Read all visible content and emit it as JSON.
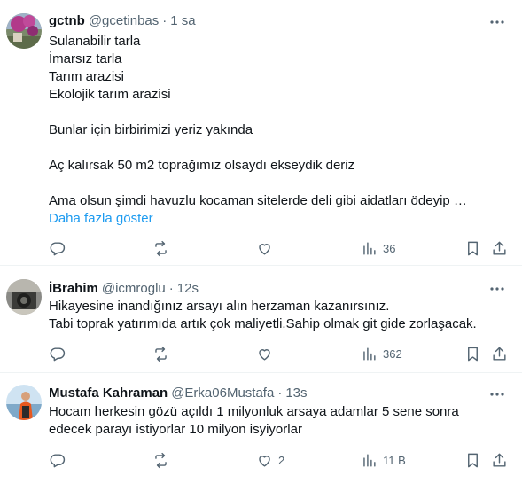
{
  "tweets": [
    {
      "name": "gctnb",
      "handle": "@gcetinbas",
      "separator": "·",
      "time": "1 sa",
      "lines": [
        "Sulanabilir tarla",
        "İmarsız tarla",
        "Tarım arazisi",
        "Ekolojik tarım arazisi",
        "",
        "Bunlar için birbirimizi yeriz yakında",
        "",
        "Aç kalırsak 50 m2 toprağımız olsaydı ekseydik deriz",
        "",
        "Ama olsun şimdi havuzlu kocaman sitelerde deli gibi aidatları ödeyip …"
      ],
      "show_more": "Daha fazla göster",
      "views": "36"
    },
    {
      "name": "İBrahim",
      "handle": "@icmroglu",
      "separator": "·",
      "time": "12s",
      "lines": [
        "Hikayesine inandığınız arsayı alın herzaman kazanırsınız.",
        "Tabi toprak yatırımıda artık çok maliyetli.Sahip olmak git gide zorlaşacak."
      ],
      "views": "362"
    },
    {
      "name": "Mustafa Kahraman",
      "handle": "@Erka06Mustafa",
      "separator": "·",
      "time": "13s",
      "lines": [
        "Hocam herkesin gözü açıldı 1 milyonluk arsaya adamlar 5 sene sonra",
        "edecek parayı istiyorlar 10 milyon isyiyorlar"
      ],
      "likes": "2",
      "views": "11 B"
    }
  ],
  "icons": {
    "reply": "reply-icon",
    "retweet": "retweet-icon",
    "like": "heart-icon",
    "views": "views-icon",
    "bookmark": "bookmark-icon",
    "share": "share-icon",
    "more": "more-icon"
  },
  "colors": {
    "link": "#1d9bf0",
    "secondary_text": "#536471",
    "primary_text": "#0f1419",
    "divider": "#eff3f4"
  }
}
